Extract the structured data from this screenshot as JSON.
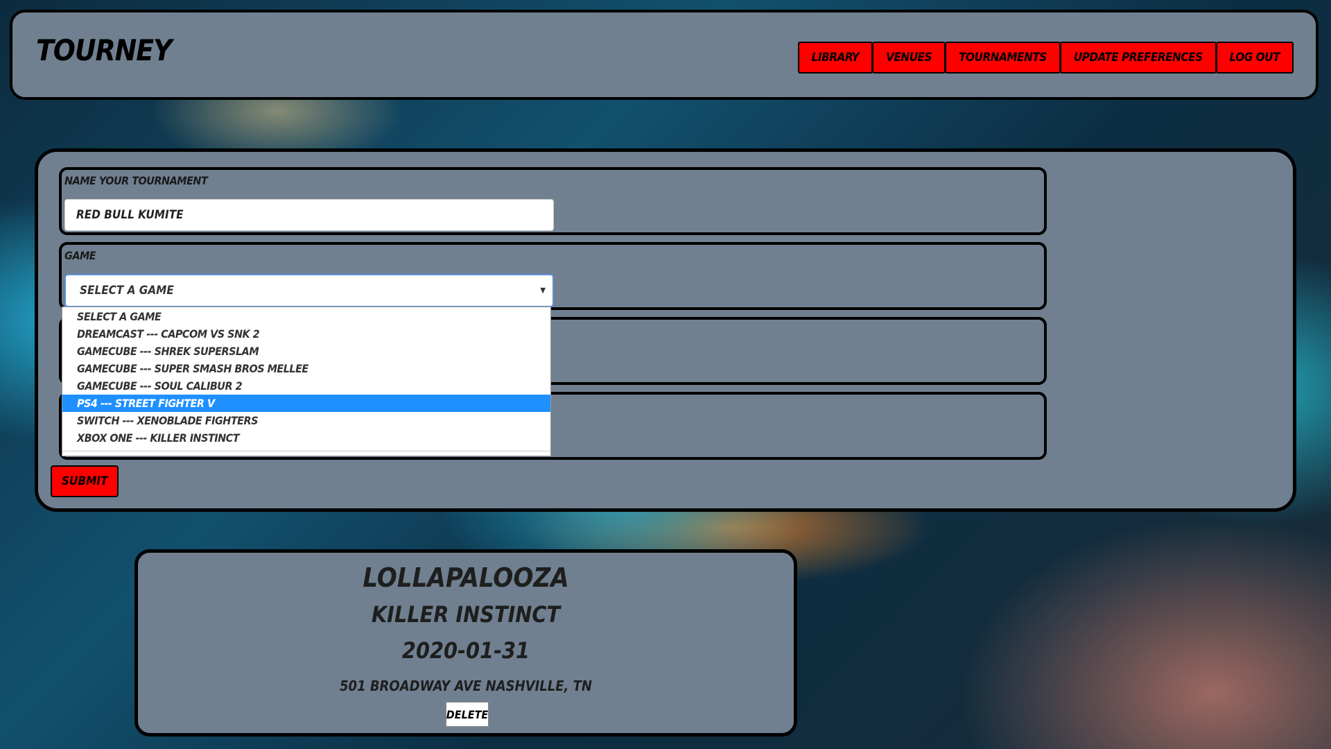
{
  "header": {
    "brand": "TOURNEY",
    "nav": [
      {
        "label": "LIBRARY"
      },
      {
        "label": "VENUES"
      },
      {
        "label": "TOURNAMENTS"
      },
      {
        "label": "UPDATE PREFERENCES"
      },
      {
        "label": "LOG OUT"
      }
    ]
  },
  "form": {
    "name_label": "NAME YOUR TOURNAMENT",
    "name_value": "RED BULL KUMITE",
    "game_label": "GAME",
    "game_selected": "SELECT A GAME",
    "game_options": [
      "SELECT A GAME",
      "DREAMCAST --- CAPCOM VS SNK 2",
      "GAMECUBE --- SHREK SUPERSLAM",
      "GAMECUBE --- SUPER SMASH BROS MELLEE",
      "GAMECUBE --- SOUL CALIBUR 2",
      "PS4 --- STREET FIGHTER V",
      "SWITCH --- XENOBLADE FIGHTERS",
      "XBOX ONE --- KILLER INSTINCT"
    ],
    "highlighted_option": "PS4 --- STREET FIGHTER V",
    "submit_label": "SUBMIT"
  },
  "card": {
    "name": "LOLLAPALOOZA",
    "game": "KILLER INSTINCT",
    "date": "2020-01-31",
    "venue": "501 BROADWAY AVE NASHVILLE, TN",
    "delete_label": "DELETE"
  },
  "colors": {
    "panel": "#708090",
    "button": "#ff0000",
    "highlight": "#1e90ff"
  }
}
